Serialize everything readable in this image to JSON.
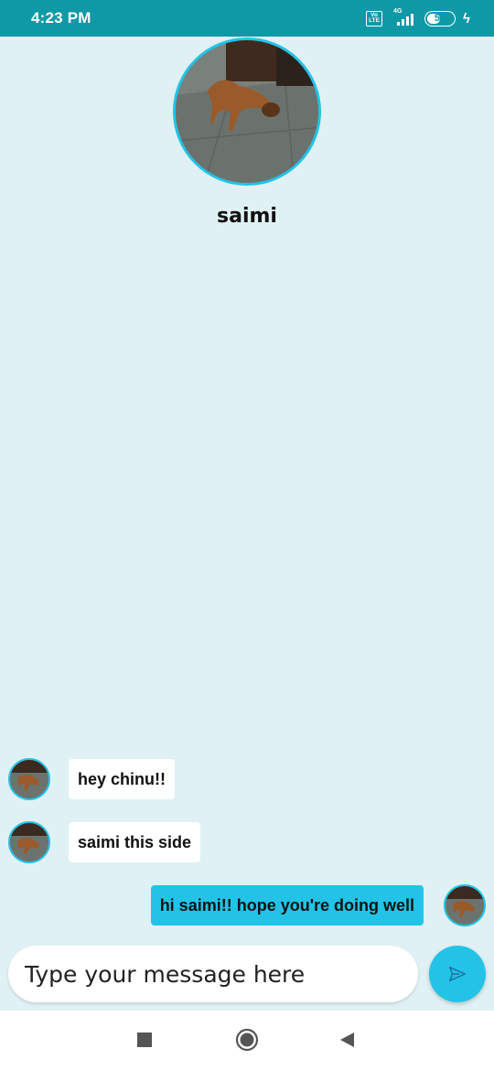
{
  "status_bar": {
    "time": "4:23 PM",
    "volte_top": "Vo",
    "volte_bottom": "LTE",
    "network": "4G",
    "battery_level": "52",
    "battery_fraction": 0.52,
    "icons": [
      "volte-icon",
      "signal-icon",
      "battery-icon",
      "charging-icon"
    ]
  },
  "contact": {
    "name": "saimi"
  },
  "messages": [
    {
      "direction": "incoming",
      "text": "hey chinu!!"
    },
    {
      "direction": "incoming",
      "text": "saimi this side"
    },
    {
      "direction": "outgoing",
      "text": "hi saimi!! hope you're doing well"
    }
  ],
  "composer": {
    "placeholder": "Type your message here",
    "value": "",
    "send_icon": "send-icon"
  },
  "nav_bar": {
    "icons": [
      "recents-square-icon",
      "home-circle-icon",
      "back-triangle-icon"
    ]
  },
  "colors": {
    "status_bar": "#0f99a6",
    "background": "#dff1f4",
    "accent": "#22c3e6",
    "incoming_bubble": "#ffffff",
    "outgoing_bubble": "#22c3e6"
  }
}
